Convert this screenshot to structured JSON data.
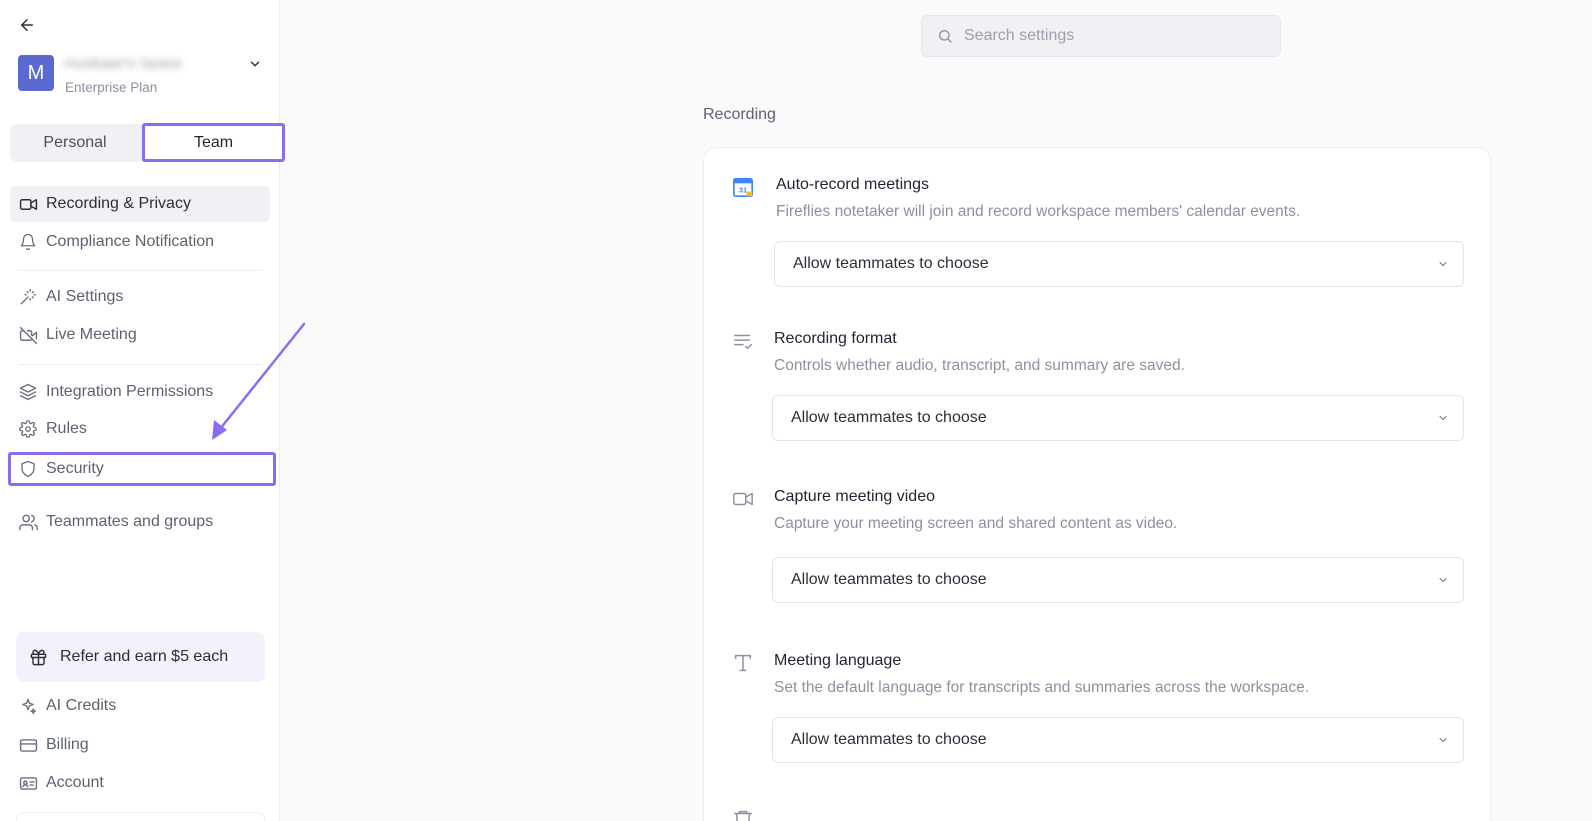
{
  "workspace": {
    "avatar_letter": "M",
    "name": "muskaan's Space",
    "plan": "Enterprise Plan"
  },
  "tabs": {
    "personal": "Personal",
    "team": "Team"
  },
  "nav": {
    "recording_privacy": "Recording & Privacy",
    "compliance": "Compliance Notification",
    "ai_settings": "AI Settings",
    "live_meeting": "Live Meeting",
    "integration_permissions": "Integration Permissions",
    "rules": "Rules",
    "security": "Security",
    "teammates": "Teammates and groups"
  },
  "footer": {
    "refer": "Refer and earn $5 each",
    "ai_credits": "AI Credits",
    "billing": "Billing",
    "account": "Account"
  },
  "search": {
    "placeholder": "Search settings"
  },
  "section": {
    "title": "Recording"
  },
  "settings": [
    {
      "title": "Auto-record meetings",
      "desc": "Fireflies notetaker will join and record workspace members' calendar events.",
      "value": "Allow teammates to choose"
    },
    {
      "title": "Recording format",
      "desc": "Controls whether audio, transcript, and summary are saved.",
      "value": "Allow teammates to choose"
    },
    {
      "title": "Capture meeting video",
      "desc": "Capture your meeting screen and shared content as video.",
      "value": "Allow teammates to choose"
    },
    {
      "title": "Meeting language",
      "desc": "Set the default language for transcripts and summaries across the workspace.",
      "value": "Allow teammates to choose"
    }
  ],
  "colors": {
    "accent": "#8b6cf0",
    "avatar": "#5b6ad0"
  }
}
